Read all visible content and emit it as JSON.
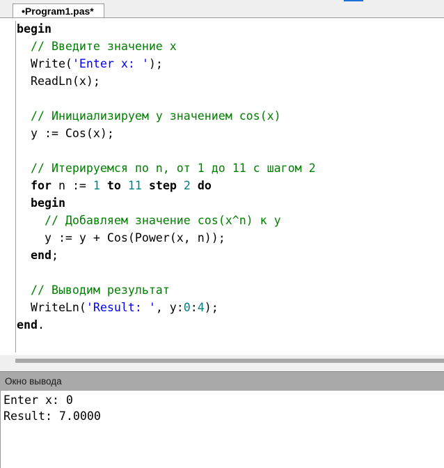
{
  "tab": {
    "title": "•Program1.pas*"
  },
  "editor": {
    "lines": [
      [
        {
          "t": "kw",
          "v": "begin"
        }
      ],
      [
        {
          "t": "cm",
          "v": "  // Введите значение x"
        }
      ],
      [
        {
          "t": "p",
          "v": "  Write("
        },
        {
          "t": "str",
          "v": "'Enter x: '"
        },
        {
          "t": "p",
          "v": ");"
        }
      ],
      [
        {
          "t": "p",
          "v": "  ReadLn(x);"
        }
      ],
      [
        {
          "t": "p",
          "v": ""
        }
      ],
      [
        {
          "t": "cm",
          "v": "  // Инициализируем y значением cos(x)"
        }
      ],
      [
        {
          "t": "p",
          "v": "  y := Cos(x);"
        }
      ],
      [
        {
          "t": "p",
          "v": ""
        }
      ],
      [
        {
          "t": "cm",
          "v": "  // Итерируемся по n, от 1 до 11 с шагом 2"
        }
      ],
      [
        {
          "t": "p",
          "v": "  "
        },
        {
          "t": "kw",
          "v": "for"
        },
        {
          "t": "p",
          "v": " n := "
        },
        {
          "t": "num",
          "v": "1"
        },
        {
          "t": "p",
          "v": " "
        },
        {
          "t": "kw",
          "v": "to"
        },
        {
          "t": "p",
          "v": " "
        },
        {
          "t": "num",
          "v": "11"
        },
        {
          "t": "p",
          "v": " "
        },
        {
          "t": "kw",
          "v": "step"
        },
        {
          "t": "p",
          "v": " "
        },
        {
          "t": "num",
          "v": "2"
        },
        {
          "t": "p",
          "v": " "
        },
        {
          "t": "kw",
          "v": "do"
        }
      ],
      [
        {
          "t": "p",
          "v": "  "
        },
        {
          "t": "kw",
          "v": "begin"
        }
      ],
      [
        {
          "t": "cm",
          "v": "    // Добавляем значение cos(x^n) к y"
        }
      ],
      [
        {
          "t": "p",
          "v": "    y := y + Cos(Power(x, n));"
        }
      ],
      [
        {
          "t": "p",
          "v": "  "
        },
        {
          "t": "kw",
          "v": "end"
        },
        {
          "t": "p",
          "v": ";"
        }
      ],
      [
        {
          "t": "p",
          "v": ""
        }
      ],
      [
        {
          "t": "cm",
          "v": "  // Выводим результат"
        }
      ],
      [
        {
          "t": "p",
          "v": "  WriteLn("
        },
        {
          "t": "str",
          "v": "'Result: '"
        },
        {
          "t": "p",
          "v": ", y:"
        },
        {
          "t": "num",
          "v": "0"
        },
        {
          "t": "p",
          "v": ":"
        },
        {
          "t": "num",
          "v": "4"
        },
        {
          "t": "p",
          "v": ");"
        }
      ],
      [
        {
          "t": "kw",
          "v": "end"
        },
        {
          "t": "p",
          "v": "."
        }
      ]
    ]
  },
  "output": {
    "header": "Окно вывода",
    "lines": [
      "Enter x: 0",
      "Result: 7.0000"
    ]
  },
  "colors": {
    "comment": "#008000",
    "string": "#0000ff",
    "number": "#008080",
    "output_header_bg": "#a9a9a9"
  }
}
